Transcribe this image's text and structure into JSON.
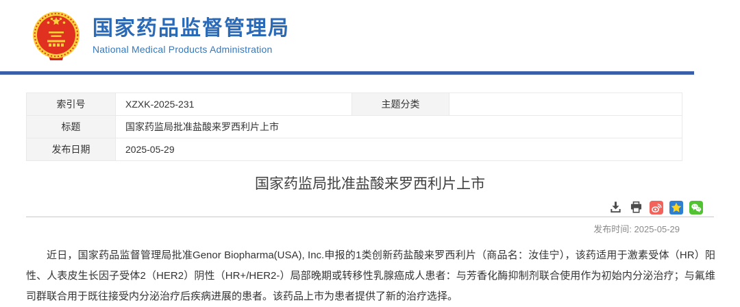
{
  "header": {
    "org_name_zh": "国家药品监督管理局",
    "org_name_en": "National Medical Products Administration",
    "logo_icon": "china-national-emblem-icon"
  },
  "info_table": {
    "row1": {
      "label_left": "索引号",
      "value_left": "XZXK-2025-231",
      "label_right": "主题分类",
      "value_right": ""
    },
    "row2": {
      "label": "标题",
      "value": "国家药监局批准盐酸来罗西利片上市"
    },
    "row3": {
      "label": "发布日期",
      "value": "2025-05-29"
    }
  },
  "article": {
    "title": "国家药监局批准盐酸来罗西利片上市",
    "publish_time_label": "发布时间:",
    "publish_time": "2025-05-29",
    "paragraph": "近日，国家药品监督管理局批准Genor Biopharma(USA), Inc.申报的1类创新药盐酸来罗西利片（商品名：汝佳宁），该药适用于激素受体（HR）阳性、人表皮生长因子受体2（HER2）阴性（HR+/HER2-）局部晚期或转移性乳腺癌成人患者：与芳香化酶抑制剂联合使用作为初始内分泌治疗；与氟维司群联合用于既往接受内分泌治疗后疾病进展的患者。该药品上市为患者提供了新的治疗选择。"
  },
  "toolbar": {
    "icon_names": [
      "download-icon",
      "print-icon",
      "weibo-share-icon",
      "qzone-share-icon",
      "wechat-share-icon"
    ]
  },
  "colors": {
    "brand_blue": "#2a69b5",
    "brand_blue_light": "#3478bd",
    "divider_blue": "#3a5fa8",
    "table_label_bg": "#f4f4f4",
    "table_border": "#e9e9e9",
    "body_text": "#333333",
    "muted_text": "#8a8a8a",
    "weibo_red": "#f2635b",
    "qzone_blue": "#2d7fd4",
    "qzone_star_gold": "#ffd31c",
    "wechat_green": "#51c332",
    "emblem_red": "#e03020",
    "emblem_gold": "#fcd03a"
  }
}
